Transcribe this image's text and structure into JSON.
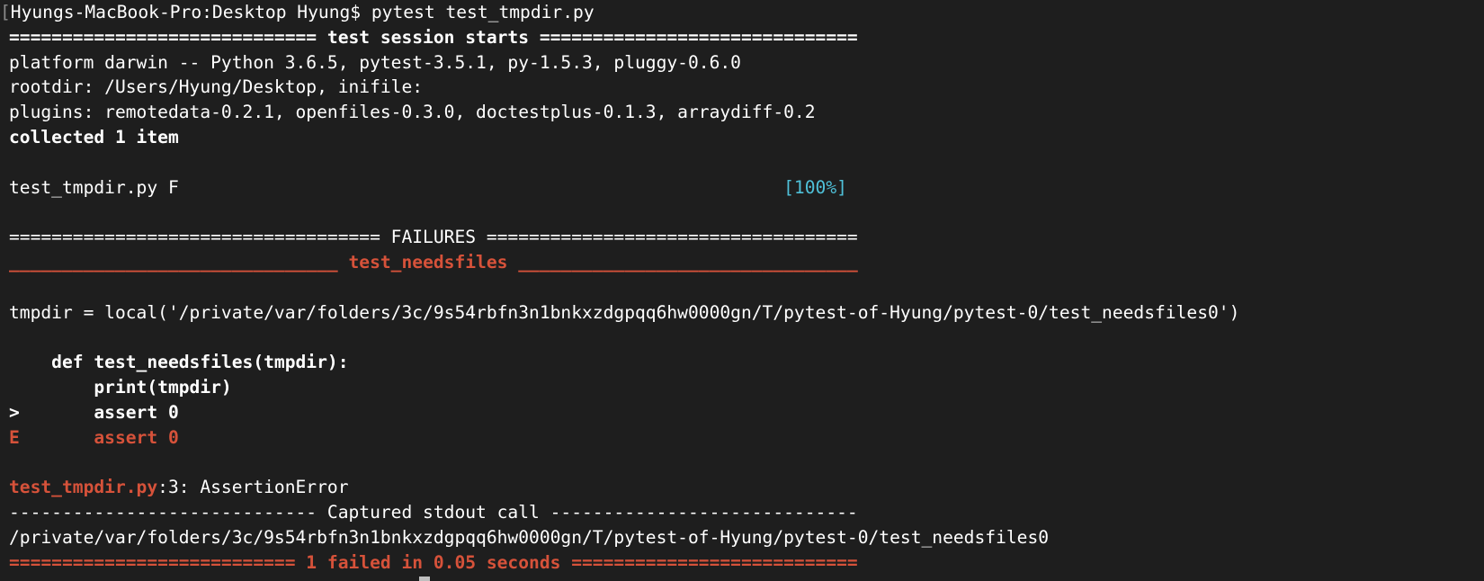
{
  "terminal": {
    "prompt": {
      "bracket": "[",
      "host": "Hyungs-MacBook-Pro:Desktop Hyung$ ",
      "command": "pytest test_tmpdir.py"
    },
    "session_header": "============================= test session starts ==============================",
    "platform": "platform darwin -- Python 3.6.5, pytest-3.5.1, py-1.5.3, pluggy-0.6.0",
    "rootdir": "rootdir: /Users/Hyung/Desktop, inifile:",
    "plugins": "plugins: remotedata-0.2.1, openfiles-0.3.0, doctestplus-0.1.3, arraydiff-0.2",
    "collected": "collected 1 item",
    "result_file": "test_tmpdir.py F                                                         ",
    "result_percent": "[100%]",
    "failures_header": "=================================== FAILURES ===================================",
    "test_name_left": "_______________________________ ",
    "test_name": "test_needsfiles",
    "test_name_right": " ________________________________",
    "tmpdir_line": "tmpdir = local('/private/var/folders/3c/9s54rbfn3n1bnkxzdgpqq6hw0000gn/T/pytest-of-Hyung/pytest-0/test_needsfiles0')",
    "code_def": "    def test_needsfiles(tmpdir):",
    "code_print": "        print(tmpdir)",
    "code_assert": ">       assert 0",
    "error_marker": "E",
    "error_text": "       assert 0",
    "location_file": "test_tmpdir.py",
    "location_rest": ":3: AssertionError",
    "captured_header": "----------------------------- Captured stdout call -----------------------------",
    "captured_output": "/private/var/folders/3c/9s54rbfn3n1bnkxzdgpqq6hw0000gn/T/pytest-of-Hyung/pytest-0/test_needsfiles0",
    "summary": "=========================== 1 failed in 0.05 seconds ==========================="
  },
  "colors": {
    "background": "#1e1e1e",
    "text": "#ffffff",
    "error_red": "#d6523a",
    "progress_cyan": "#4fc1d9"
  }
}
